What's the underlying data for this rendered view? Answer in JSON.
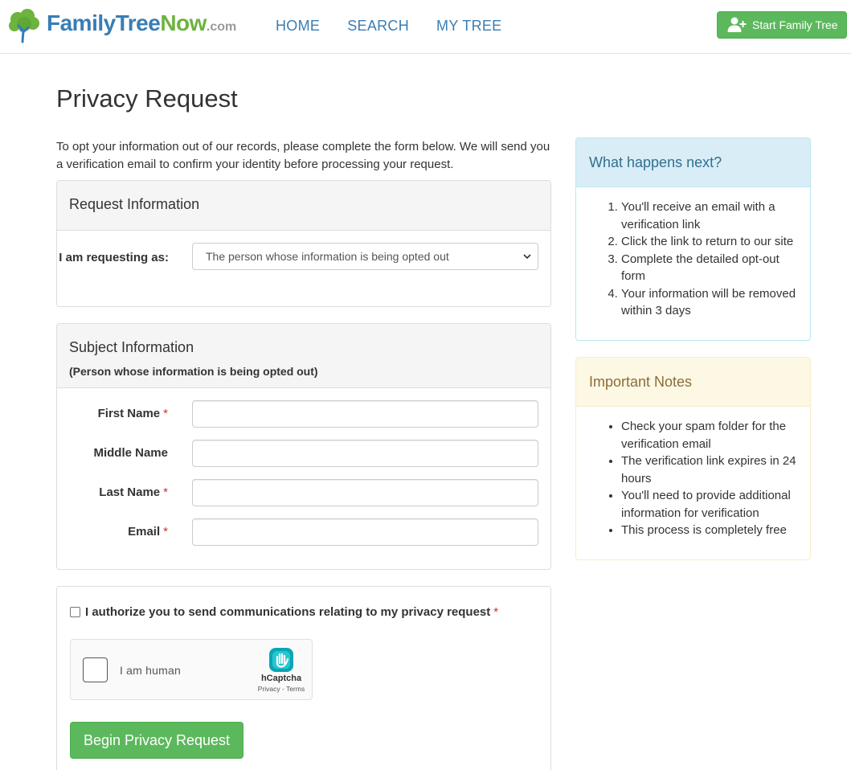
{
  "header": {
    "logo": {
      "family": "Family",
      "tree": "Tree",
      "now": "Now",
      "com": ".com",
      "icon": "tree-logo-icon"
    },
    "nav": [
      {
        "label": "HOME"
      },
      {
        "label": "SEARCH"
      },
      {
        "label": "MY TREE"
      }
    ],
    "start_button": {
      "label": "Start Family Tree",
      "icon": "add-user-icon"
    }
  },
  "page": {
    "title": "Privacy Request",
    "intro": "To opt your information out of our records, please complete the form below. We will send you a verification email to confirm your identity before processing your request."
  },
  "request_panel": {
    "title": "Request Information",
    "requesting_label": "I am requesting as:",
    "requesting_value": "The person whose information is being opted out"
  },
  "subject_panel": {
    "title": "Subject Information",
    "subtitle": "(Person whose information is being opted out)",
    "fields": {
      "first_name": {
        "label": "First Name",
        "value": ""
      },
      "middle_name": {
        "label": "Middle Name",
        "value": ""
      },
      "last_name": {
        "label": "Last Name",
        "value": ""
      },
      "email": {
        "label": "Email",
        "value": ""
      }
    },
    "required_mark": "*"
  },
  "authorization": {
    "label": "I authorize you to send communications relating to my privacy request",
    "checked": false,
    "captcha": {
      "text": "I am human",
      "brand": "hCaptcha",
      "links": "Privacy - Terms"
    },
    "submit_label": "Begin Privacy Request"
  },
  "sidebar": {
    "next": {
      "title": "What happens next?",
      "steps": [
        "You'll receive an email with a verification link",
        "Click the link to return to our site",
        "Complete the detailed opt-out form",
        "Your information will be removed within 3 days"
      ]
    },
    "notes": {
      "title": "Important Notes",
      "items": [
        "Check your spam folder for the verification email",
        "The verification link expires in 24 hours",
        "You'll need to provide additional information for verification",
        "This process is completely free"
      ]
    }
  },
  "colors": {
    "brand_blue": "#3a7db4",
    "brand_green": "#6db33f",
    "button_green": "#5cb85c",
    "info_heading_bg": "#d9edf7",
    "info_border": "#bce8f1",
    "warning_heading_bg": "#fcf8e3",
    "warning_border": "#faebcc",
    "required_red": "#c9302c"
  }
}
